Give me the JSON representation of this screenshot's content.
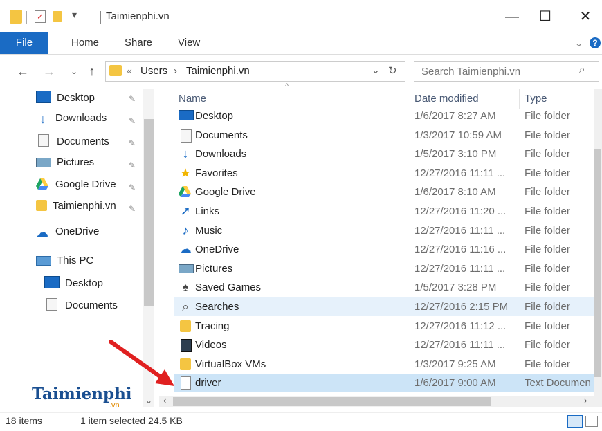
{
  "window": {
    "title": "Taimienphi.vn",
    "minimize": "—",
    "maximize": "☐",
    "close": "✕"
  },
  "ribbon": {
    "tabs": [
      "File",
      "Home",
      "Share",
      "View"
    ],
    "expand": "⌄",
    "help": "?"
  },
  "address": {
    "chevrons": "«",
    "path": [
      "Users",
      "Taimienphi.vn"
    ],
    "sep": "›",
    "dropdown": "⌄",
    "refresh": "↻"
  },
  "search": {
    "placeholder": "Search Taimienphi.vn"
  },
  "nav_pane": {
    "quick_access": [
      "Desktop",
      "Downloads",
      "Documents",
      "Pictures",
      "Google Drive",
      "Taimienphi.vn"
    ],
    "onedrive": "OneDrive",
    "this_pc": "This PC",
    "this_pc_children": [
      "Desktop",
      "Documents"
    ]
  },
  "columns": {
    "name": "Name",
    "date": "Date modified",
    "type": "Type"
  },
  "files": [
    {
      "name": "Desktop",
      "date": "1/6/2017 8:27 AM",
      "type": "File folder",
      "icon": "desktop-icon"
    },
    {
      "name": "Documents",
      "date": "1/3/2017 10:59 AM",
      "type": "File folder",
      "icon": "documents-icon"
    },
    {
      "name": "Downloads",
      "date": "1/5/2017 3:10 PM",
      "type": "File folder",
      "icon": "downloads-icon"
    },
    {
      "name": "Favorites",
      "date": "12/27/2016 11:11 ...",
      "type": "File folder",
      "icon": "favorites-icon"
    },
    {
      "name": "Google Drive",
      "date": "1/6/2017 8:10 AM",
      "type": "File folder",
      "icon": "google-drive-icon"
    },
    {
      "name": "Links",
      "date": "12/27/2016 11:20 ...",
      "type": "File folder",
      "icon": "links-icon"
    },
    {
      "name": "Music",
      "date": "12/27/2016 11:11 ...",
      "type": "File folder",
      "icon": "music-icon"
    },
    {
      "name": "OneDrive",
      "date": "12/27/2016 11:16 ...",
      "type": "File folder",
      "icon": "onedrive-icon"
    },
    {
      "name": "Pictures",
      "date": "12/27/2016 11:11 ...",
      "type": "File folder",
      "icon": "pictures-icon"
    },
    {
      "name": "Saved Games",
      "date": "1/5/2017 3:28 PM",
      "type": "File folder",
      "icon": "saved-games-icon"
    },
    {
      "name": "Searches",
      "date": "12/27/2016 2:15 PM",
      "type": "File folder",
      "icon": "searches-icon"
    },
    {
      "name": "Tracing",
      "date": "12/27/2016 11:12 ...",
      "type": "File folder",
      "icon": "folder-icon"
    },
    {
      "name": "Videos",
      "date": "12/27/2016 11:11 ...",
      "type": "File folder",
      "icon": "videos-icon"
    },
    {
      "name": "VirtualBox VMs",
      "date": "1/3/2017 9:25 AM",
      "type": "File folder",
      "icon": "folder-icon"
    },
    {
      "name": "driver",
      "date": "1/6/2017 9:00 AM",
      "type": "Text Documen",
      "icon": "text-file-icon"
    }
  ],
  "status": {
    "count": "18 items",
    "selection": "1 item selected  24.5 KB"
  },
  "watermark": {
    "brand": "Taimienphi",
    "sub": ".vn"
  },
  "colors": {
    "accent": "#1a6bc4",
    "selected_row": "#cce4f7",
    "hover_row": "#e6f1fb",
    "arrow": "#e02020"
  }
}
